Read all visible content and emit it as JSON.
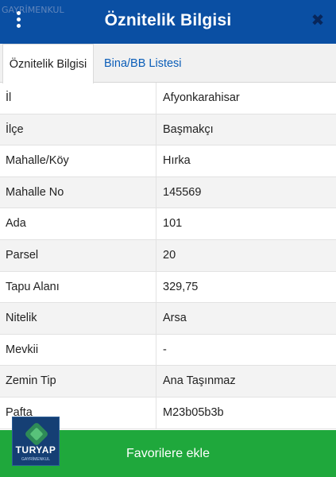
{
  "watermark": "GAYRİMENKUL",
  "header": {
    "title": "Öznitelik Bilgisi",
    "menu_icon": "more-vert-icon",
    "close_icon": "close-icon",
    "close_glyph": "✖",
    "color": "#0a4fa3"
  },
  "tabs": [
    {
      "label": "Öznitelik Bilgisi",
      "active": true
    },
    {
      "label": "Bina/BB Listesi",
      "active": false
    }
  ],
  "attributes": [
    {
      "label": "İl",
      "value": "Afyonkarahisar"
    },
    {
      "label": "İlçe",
      "value": "Başmakçı"
    },
    {
      "label": "Mahalle/Köy",
      "value": "Hırka"
    },
    {
      "label": "Mahalle No",
      "value": "145569"
    },
    {
      "label": "Ada",
      "value": "101"
    },
    {
      "label": "Parsel",
      "value": "20"
    },
    {
      "label": "Tapu Alanı",
      "value": "329,75"
    },
    {
      "label": "Nitelik",
      "value": "Arsa"
    },
    {
      "label": "Mevkii",
      "value": "-"
    },
    {
      "label": "Zemin Tip",
      "value": "Ana Taşınmaz"
    },
    {
      "label": "Pafta",
      "value": "M23b05b3b"
    }
  ],
  "footer": {
    "favorite_label": "Favorilere ekle",
    "color": "#1fa83c"
  },
  "logo": {
    "name": "TURYAP",
    "tagline": "GAYRİMENKUL"
  }
}
